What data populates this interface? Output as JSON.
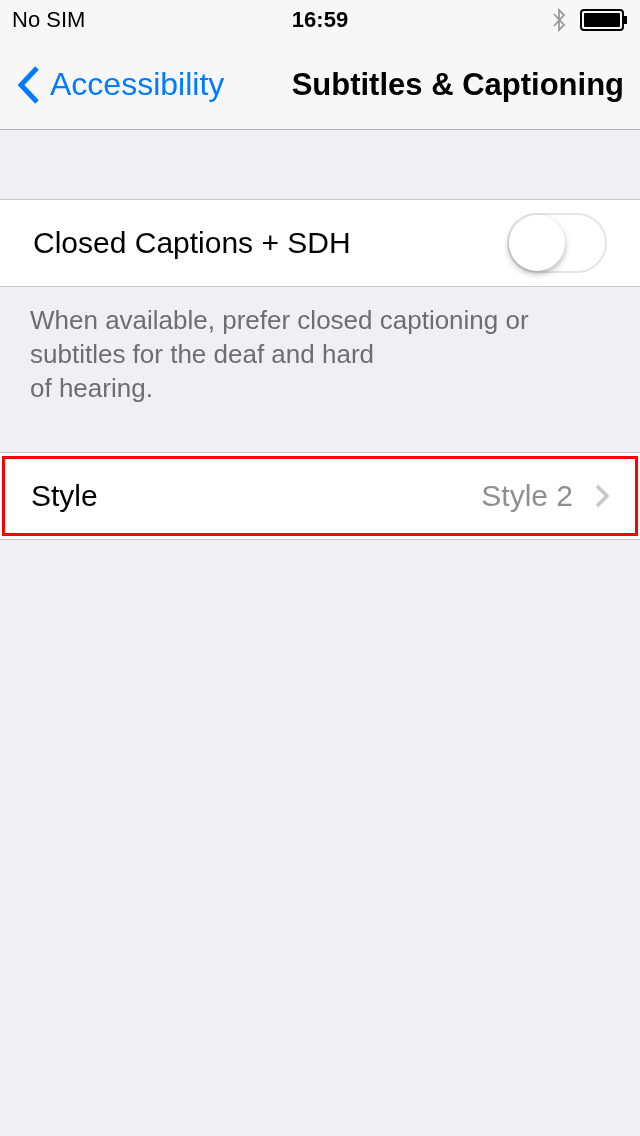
{
  "status_bar": {
    "carrier": "No SIM",
    "time": "16:59"
  },
  "nav": {
    "back": "Accessibility",
    "title": "Subtitles & Captioning"
  },
  "sections": [
    {
      "rows": [
        {
          "kind": "toggle",
          "label": "Closed Captions + SDH",
          "on": false,
          "highlighted": false
        }
      ],
      "footer": "When available, prefer closed captioning or\nsubtitles for the deaf and hard\nof hearing."
    },
    {
      "rows": [
        {
          "kind": "disclosure",
          "label": "Style",
          "value": "Style 2",
          "highlighted": true
        }
      ]
    }
  ]
}
